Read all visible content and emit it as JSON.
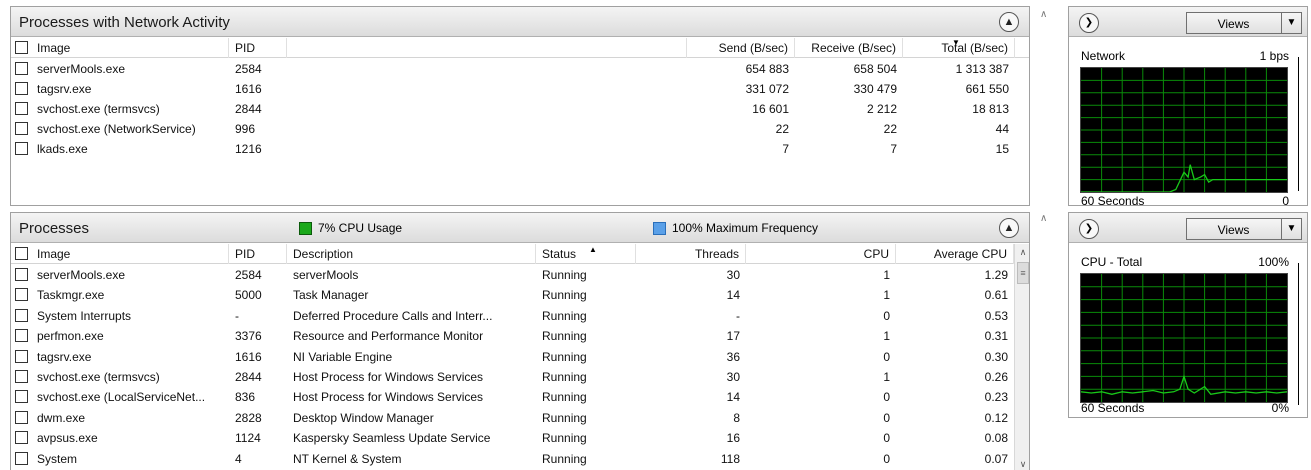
{
  "network_panel": {
    "title": "Processes with Network Activity",
    "columns": [
      "Image",
      "PID",
      "Send (B/sec)",
      "Receive (B/sec)",
      "Total (B/sec)"
    ],
    "rows": [
      {
        "image": "serverMools.exe",
        "pid": "2584",
        "send": "654 883",
        "receive": "658 504",
        "total": "1 313 387"
      },
      {
        "image": "tagsrv.exe",
        "pid": "1616",
        "send": "331 072",
        "receive": "330 479",
        "total": "661 550"
      },
      {
        "image": "svchost.exe (termsvcs)",
        "pid": "2844",
        "send": "16 601",
        "receive": "2 212",
        "total": "18 813"
      },
      {
        "image": "svchost.exe (NetworkService)",
        "pid": "996",
        "send": "22",
        "receive": "22",
        "total": "44"
      },
      {
        "image": "lkads.exe",
        "pid": "1216",
        "send": "7",
        "receive": "7",
        "total": "15"
      }
    ]
  },
  "processes_panel": {
    "title": "Processes",
    "cpu_usage": "7% CPU Usage",
    "max_freq": "100% Maximum Frequency",
    "cpu_legend_color": "#1aa81a",
    "freq_legend_color": "#5aa0e8",
    "columns": [
      "Image",
      "PID",
      "Description",
      "Status",
      "Threads",
      "CPU",
      "Average CPU"
    ],
    "rows": [
      {
        "image": "serverMools.exe",
        "pid": "2584",
        "desc": "serverMools",
        "status": "Running",
        "threads": "30",
        "cpu": "1",
        "avg": "1.29"
      },
      {
        "image": "Taskmgr.exe",
        "pid": "5000",
        "desc": "Task Manager",
        "status": "Running",
        "threads": "14",
        "cpu": "1",
        "avg": "0.61"
      },
      {
        "image": "System Interrupts",
        "pid": "-",
        "desc": "Deferred Procedure Calls and Interr...",
        "status": "Running",
        "threads": "-",
        "cpu": "0",
        "avg": "0.53"
      },
      {
        "image": "perfmon.exe",
        "pid": "3376",
        "desc": "Resource and Performance Monitor",
        "status": "Running",
        "threads": "17",
        "cpu": "1",
        "avg": "0.31"
      },
      {
        "image": "tagsrv.exe",
        "pid": "1616",
        "desc": "NI Variable Engine",
        "status": "Running",
        "threads": "36",
        "cpu": "0",
        "avg": "0.30"
      },
      {
        "image": "svchost.exe (termsvcs)",
        "pid": "2844",
        "desc": "Host Process for Windows Services",
        "status": "Running",
        "threads": "30",
        "cpu": "1",
        "avg": "0.26"
      },
      {
        "image": "svchost.exe (LocalServiceNet...",
        "pid": "836",
        "desc": "Host Process for Windows Services",
        "status": "Running",
        "threads": "14",
        "cpu": "0",
        "avg": "0.23"
      },
      {
        "image": "dwm.exe",
        "pid": "2828",
        "desc": "Desktop Window Manager",
        "status": "Running",
        "threads": "8",
        "cpu": "0",
        "avg": "0.12"
      },
      {
        "image": "avpsus.exe",
        "pid": "1124",
        "desc": "Kaspersky Seamless Update Service",
        "status": "Running",
        "threads": "16",
        "cpu": "0",
        "avg": "0.08"
      },
      {
        "image": "System",
        "pid": "4",
        "desc": "NT Kernel & System",
        "status": "Running",
        "threads": "118",
        "cpu": "0",
        "avg": "0.07"
      }
    ]
  },
  "network_graph": {
    "views_label": "Views",
    "title": "Network",
    "scale": "1 bps",
    "footer_left": "60 Seconds",
    "footer_right": "0",
    "line_color": "#19c819",
    "grid_color": "#0a8c0a"
  },
  "cpu_graph": {
    "views_label": "Views",
    "title": "CPU - Total",
    "scale": "100%",
    "footer_left": "60 Seconds",
    "footer_right": "0%",
    "line_color": "#19c819",
    "grid_color": "#0a8c0a"
  }
}
